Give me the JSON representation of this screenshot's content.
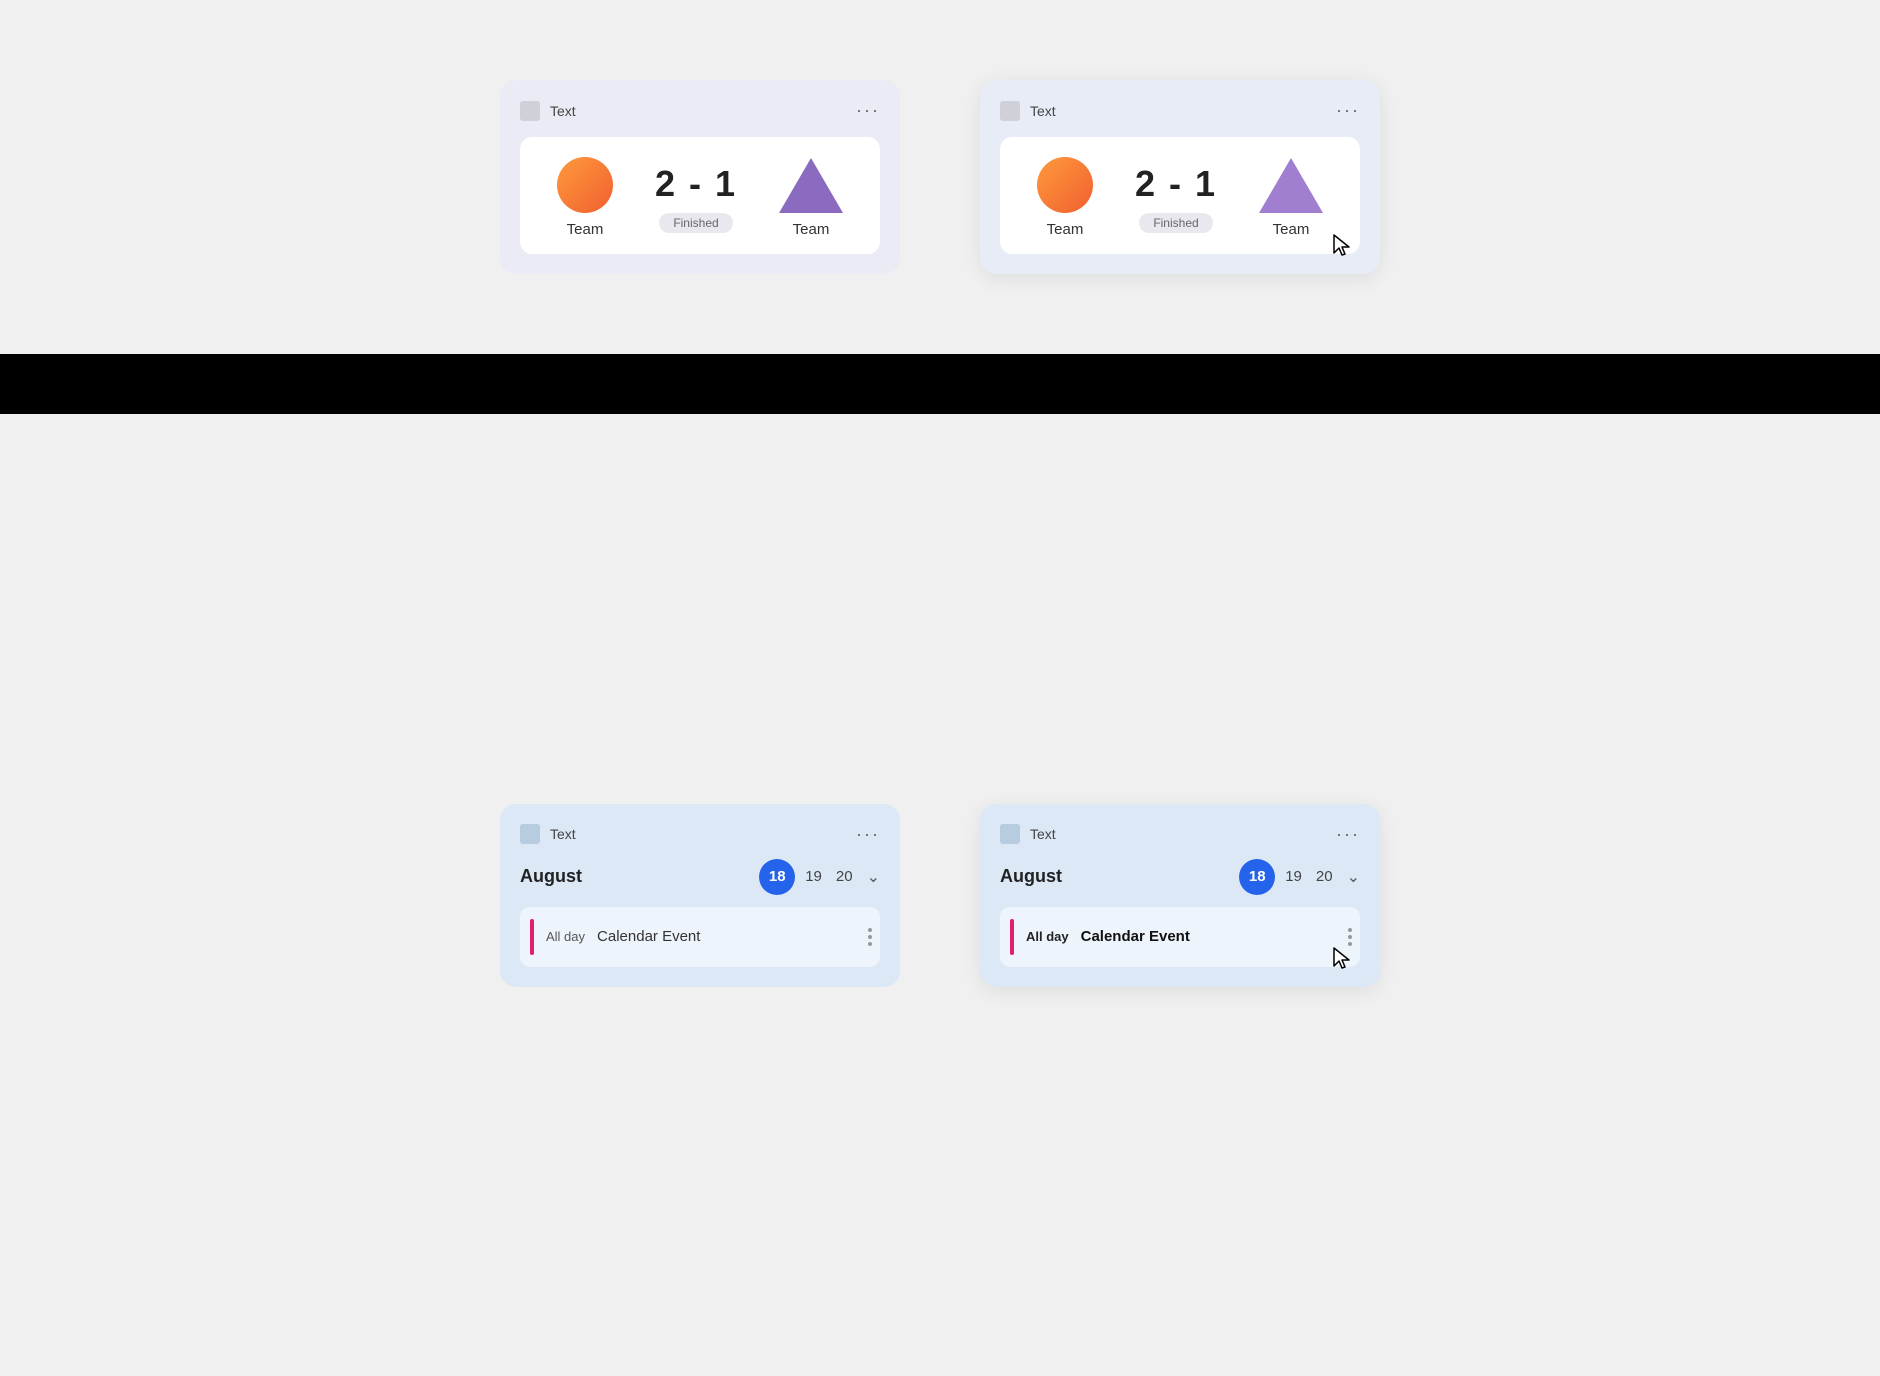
{
  "cards": {
    "score_card_left": {
      "header_text": "Text",
      "more_label": "···",
      "team1_label": "Team",
      "score": "2 - 1",
      "status": "Finished",
      "team2_label": "Team"
    },
    "score_card_right": {
      "header_text": "Text",
      "more_label": "···",
      "team1_label": "Team",
      "score": "2 - 1",
      "status": "Finished",
      "team2_label": "Team"
    },
    "calendar_card_left": {
      "header_text": "Text",
      "more_label": "···",
      "month": "August",
      "date_active": "18",
      "date2": "19",
      "date3": "20",
      "all_day": "All day",
      "event_title": "Calendar Event"
    },
    "calendar_card_right": {
      "header_text": "Text",
      "more_label": "···",
      "month": "August",
      "date_active": "18",
      "date2": "19",
      "date3": "20",
      "all_day": "All day",
      "event_title": "Calendar Event"
    }
  }
}
